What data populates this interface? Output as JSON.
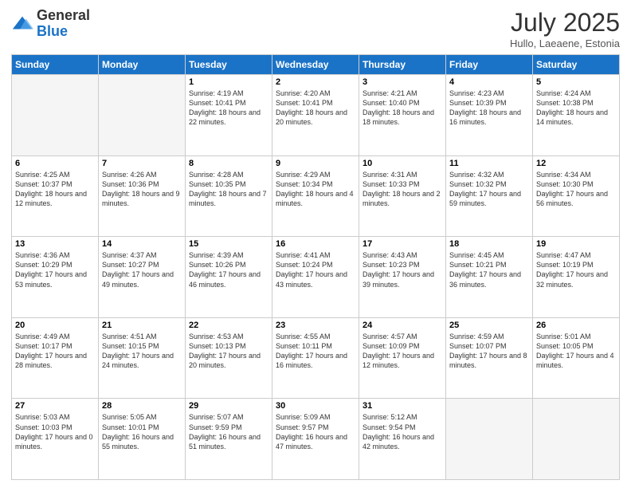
{
  "header": {
    "logo_general": "General",
    "logo_blue": "Blue",
    "month_title": "July 2025",
    "subtitle": "Hullo, Laeaene, Estonia"
  },
  "days_of_week": [
    "Sunday",
    "Monday",
    "Tuesday",
    "Wednesday",
    "Thursday",
    "Friday",
    "Saturday"
  ],
  "weeks": [
    [
      {
        "day": "",
        "info": ""
      },
      {
        "day": "",
        "info": ""
      },
      {
        "day": "1",
        "info": "Sunrise: 4:19 AM\nSunset: 10:41 PM\nDaylight: 18 hours and 22 minutes."
      },
      {
        "day": "2",
        "info": "Sunrise: 4:20 AM\nSunset: 10:41 PM\nDaylight: 18 hours and 20 minutes."
      },
      {
        "day": "3",
        "info": "Sunrise: 4:21 AM\nSunset: 10:40 PM\nDaylight: 18 hours and 18 minutes."
      },
      {
        "day": "4",
        "info": "Sunrise: 4:23 AM\nSunset: 10:39 PM\nDaylight: 18 hours and 16 minutes."
      },
      {
        "day": "5",
        "info": "Sunrise: 4:24 AM\nSunset: 10:38 PM\nDaylight: 18 hours and 14 minutes."
      }
    ],
    [
      {
        "day": "6",
        "info": "Sunrise: 4:25 AM\nSunset: 10:37 PM\nDaylight: 18 hours and 12 minutes."
      },
      {
        "day": "7",
        "info": "Sunrise: 4:26 AM\nSunset: 10:36 PM\nDaylight: 18 hours and 9 minutes."
      },
      {
        "day": "8",
        "info": "Sunrise: 4:28 AM\nSunset: 10:35 PM\nDaylight: 18 hours and 7 minutes."
      },
      {
        "day": "9",
        "info": "Sunrise: 4:29 AM\nSunset: 10:34 PM\nDaylight: 18 hours and 4 minutes."
      },
      {
        "day": "10",
        "info": "Sunrise: 4:31 AM\nSunset: 10:33 PM\nDaylight: 18 hours and 2 minutes."
      },
      {
        "day": "11",
        "info": "Sunrise: 4:32 AM\nSunset: 10:32 PM\nDaylight: 17 hours and 59 minutes."
      },
      {
        "day": "12",
        "info": "Sunrise: 4:34 AM\nSunset: 10:30 PM\nDaylight: 17 hours and 56 minutes."
      }
    ],
    [
      {
        "day": "13",
        "info": "Sunrise: 4:36 AM\nSunset: 10:29 PM\nDaylight: 17 hours and 53 minutes."
      },
      {
        "day": "14",
        "info": "Sunrise: 4:37 AM\nSunset: 10:27 PM\nDaylight: 17 hours and 49 minutes."
      },
      {
        "day": "15",
        "info": "Sunrise: 4:39 AM\nSunset: 10:26 PM\nDaylight: 17 hours and 46 minutes."
      },
      {
        "day": "16",
        "info": "Sunrise: 4:41 AM\nSunset: 10:24 PM\nDaylight: 17 hours and 43 minutes."
      },
      {
        "day": "17",
        "info": "Sunrise: 4:43 AM\nSunset: 10:23 PM\nDaylight: 17 hours and 39 minutes."
      },
      {
        "day": "18",
        "info": "Sunrise: 4:45 AM\nSunset: 10:21 PM\nDaylight: 17 hours and 36 minutes."
      },
      {
        "day": "19",
        "info": "Sunrise: 4:47 AM\nSunset: 10:19 PM\nDaylight: 17 hours and 32 minutes."
      }
    ],
    [
      {
        "day": "20",
        "info": "Sunrise: 4:49 AM\nSunset: 10:17 PM\nDaylight: 17 hours and 28 minutes."
      },
      {
        "day": "21",
        "info": "Sunrise: 4:51 AM\nSunset: 10:15 PM\nDaylight: 17 hours and 24 minutes."
      },
      {
        "day": "22",
        "info": "Sunrise: 4:53 AM\nSunset: 10:13 PM\nDaylight: 17 hours and 20 minutes."
      },
      {
        "day": "23",
        "info": "Sunrise: 4:55 AM\nSunset: 10:11 PM\nDaylight: 17 hours and 16 minutes."
      },
      {
        "day": "24",
        "info": "Sunrise: 4:57 AM\nSunset: 10:09 PM\nDaylight: 17 hours and 12 minutes."
      },
      {
        "day": "25",
        "info": "Sunrise: 4:59 AM\nSunset: 10:07 PM\nDaylight: 17 hours and 8 minutes."
      },
      {
        "day": "26",
        "info": "Sunrise: 5:01 AM\nSunset: 10:05 PM\nDaylight: 17 hours and 4 minutes."
      }
    ],
    [
      {
        "day": "27",
        "info": "Sunrise: 5:03 AM\nSunset: 10:03 PM\nDaylight: 17 hours and 0 minutes."
      },
      {
        "day": "28",
        "info": "Sunrise: 5:05 AM\nSunset: 10:01 PM\nDaylight: 16 hours and 55 minutes."
      },
      {
        "day": "29",
        "info": "Sunrise: 5:07 AM\nSunset: 9:59 PM\nDaylight: 16 hours and 51 minutes."
      },
      {
        "day": "30",
        "info": "Sunrise: 5:09 AM\nSunset: 9:57 PM\nDaylight: 16 hours and 47 minutes."
      },
      {
        "day": "31",
        "info": "Sunrise: 5:12 AM\nSunset: 9:54 PM\nDaylight: 16 hours and 42 minutes."
      },
      {
        "day": "",
        "info": ""
      },
      {
        "day": "",
        "info": ""
      }
    ]
  ]
}
